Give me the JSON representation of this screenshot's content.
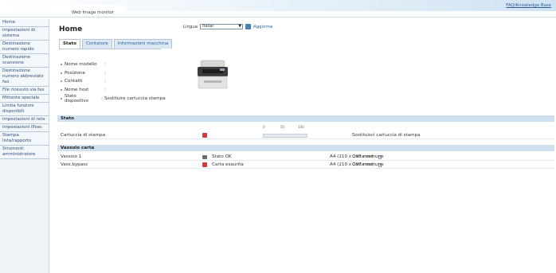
{
  "header": {
    "app_title": "Web Image monitor",
    "faq_link": "FAQ/Knowledge Base"
  },
  "sidebar": {
    "items": [
      "Home",
      "Impostazioni di sistema",
      "Destinazione numero rapido",
      "Destinazione scansione",
      "Destinazione numero abbreviato fax",
      "File ricevuto via fax",
      "Mittente speciale",
      "Limita funzioni disponibili",
      "Impostazioni di rete",
      "Impostazioni IPsec",
      "Stampa lista/rapporto",
      "Strumenti amministratore"
    ]
  },
  "main": {
    "title": "Home",
    "language_label": "Lingua",
    "language_value": "Italiar",
    "refresh_label": "Aggiorna",
    "tabs": [
      "Stato",
      "Contatore",
      "Informazioni macchina"
    ],
    "info": {
      "model_label": "Nome modello",
      "position_label": "Posizione",
      "contacts_label": "Contatti",
      "host_label": "Nome host",
      "status_label": "Stato dispositivo",
      "colon": ":",
      "status_value": "Sostituire cartuccia stampa"
    },
    "stato_section": "Stato",
    "cartridge": {
      "label": "Cartuccia di stampa",
      "scale": [
        "0",
        "50",
        "100"
      ],
      "level_percent": 0,
      "status": "Sostituisci cartuccia di stampa"
    },
    "tray_section": "Vassoio carta",
    "trays": [
      {
        "name": "Vassoio 1",
        "status": "Stato OK",
        "size": "A4 (210 x 297 mm)",
        "type": "Carta comune",
        "icon": "ok"
      },
      {
        "name": "Vass.bypass",
        "status": "Carta esaurita",
        "size": "A4 (210 x 297 mm)",
        "type": "Carta comune",
        "icon": "warn"
      }
    ]
  },
  "colors": {
    "accent": "#2f5f9a",
    "section": "#cfe0f0",
    "sidebar": "#eef3f8",
    "warn": "#d23b3b"
  }
}
